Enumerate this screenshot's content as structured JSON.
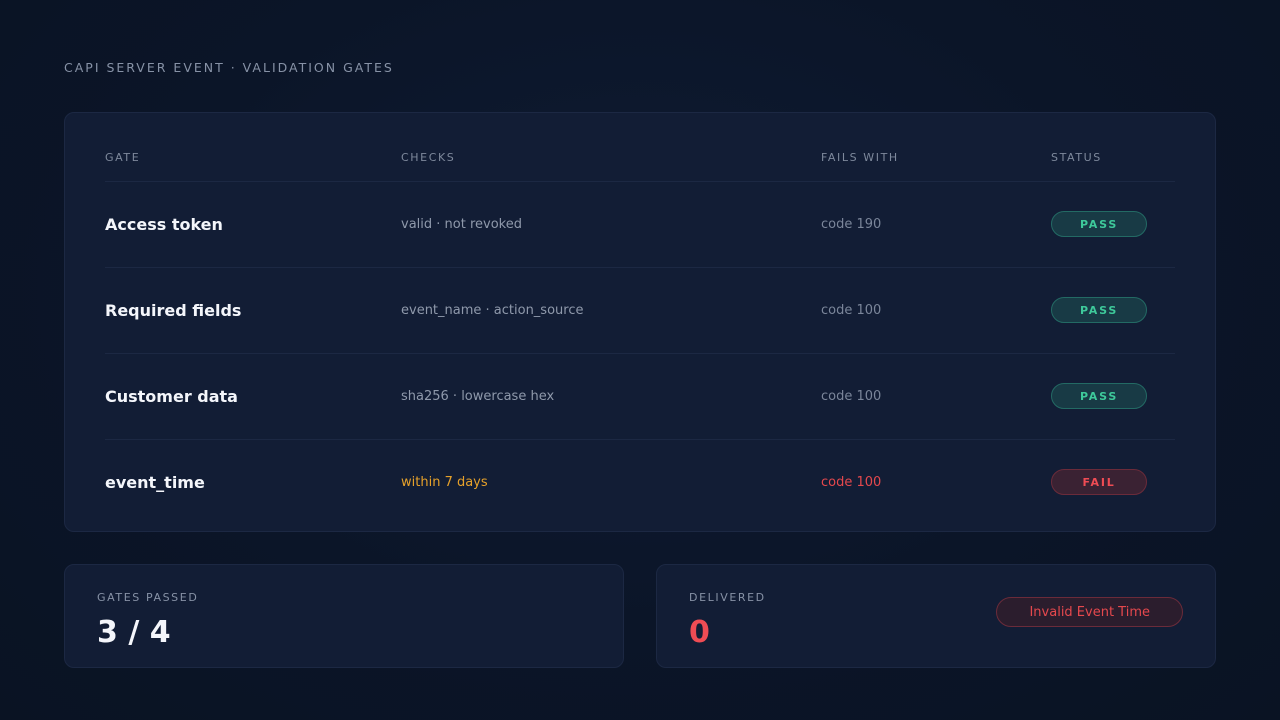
{
  "page": {
    "title": "CAPI SERVER EVENT · VALIDATION GATES"
  },
  "table": {
    "columns": [
      "GATE",
      "CHECKS",
      "FAILS WITH",
      "STATUS"
    ],
    "rows": [
      {
        "gate": "Access token",
        "checks": "valid · not revoked",
        "fails_with": "code 190",
        "status": "PASS"
      },
      {
        "gate": "Required fields",
        "checks": "event_name · action_source",
        "fails_with": "code 100",
        "status": "PASS"
      },
      {
        "gate": "Customer data",
        "checks": "sha256 · lowercase hex",
        "fails_with": "code 100",
        "status": "PASS"
      },
      {
        "gate": "event_time",
        "checks": "within 7 days",
        "fails_with": "code 100",
        "status": "FAIL"
      }
    ]
  },
  "summary": {
    "gates_passed_label": "GATES PASSED",
    "gates_passed_value": "3 / 4",
    "delivered_label": "DELIVERED",
    "delivered_value": "0",
    "error_label": "Invalid Event Time"
  },
  "colors": {
    "background": "#0b1528",
    "card": "#121d35",
    "pass": "#3ec99a",
    "fail": "#ef4c54",
    "warning": "#e6a12a"
  }
}
